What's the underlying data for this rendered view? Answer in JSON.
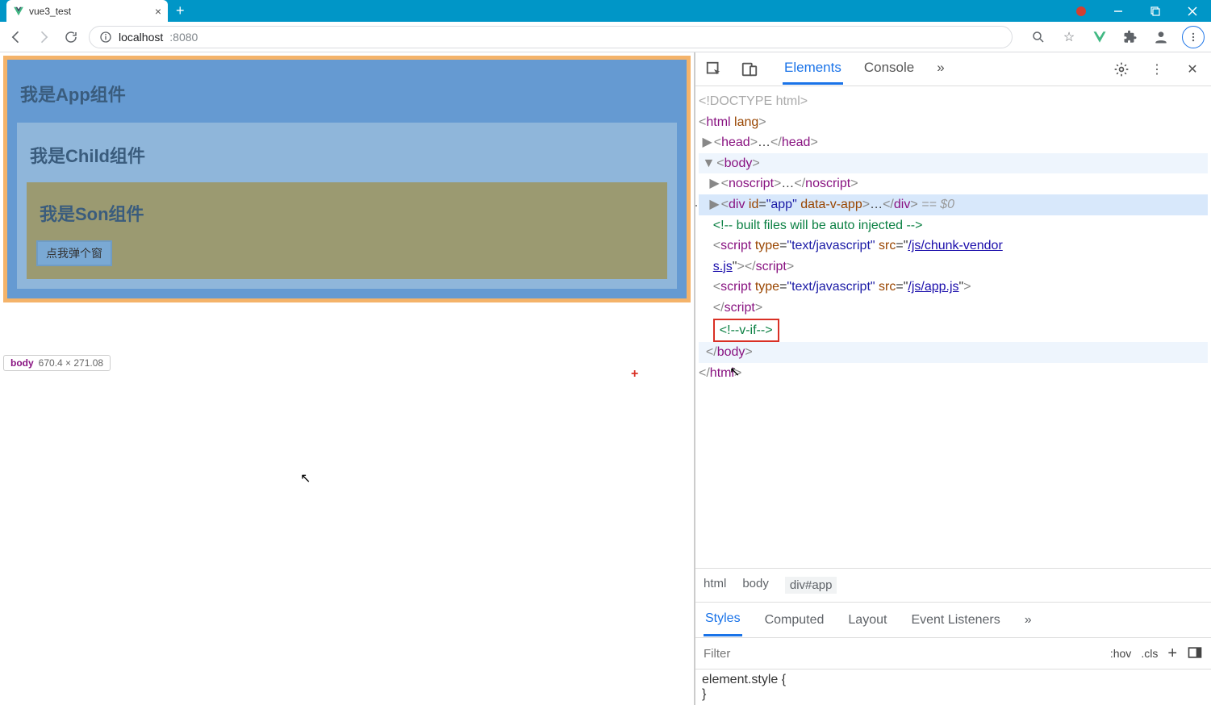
{
  "browser": {
    "tab_title": "vue3_test",
    "url_host": "localhost",
    "url_port": ":8080"
  },
  "page": {
    "app_title": "我是App组件",
    "child_title": "我是Child组件",
    "son_title": "我是Son组件",
    "button_label": "点我弹个窗",
    "hint_element": "body",
    "hint_dims": "670.4 × 271.08"
  },
  "devtools": {
    "tabs": {
      "elements": "Elements",
      "console": "Console"
    },
    "dom": {
      "doctype": "<!DOCTYPE html>",
      "html_open": "html",
      "lang_attr": "lang",
      "head": "head",
      "body": "body",
      "noscript": "noscript",
      "div": "div",
      "id_attr": "id",
      "id_val": "\"app\"",
      "data_v_app": "data-v-app",
      "eq0": "== $0",
      "comment_built": "<!-- built files will be auto injected -->",
      "script": "script",
      "type_attr": "type",
      "type_val": "\"text/javascript\"",
      "src_attr": "src",
      "src1a": "/js/chunk-vendor",
      "src1b": "s.js",
      "src2": "/js/app.js",
      "vif": "<!--v-if-->",
      "html_close": "html"
    },
    "breadcrumb": {
      "html": "html",
      "body": "body",
      "app": "div#app"
    },
    "styles_tabs": {
      "styles": "Styles",
      "computed": "Computed",
      "layout": "Layout",
      "listeners": "Event Listeners"
    },
    "filter_placeholder": "Filter",
    "hov": ":hov",
    "cls": ".cls",
    "style_rule": "element.style {",
    "style_close": "}"
  }
}
